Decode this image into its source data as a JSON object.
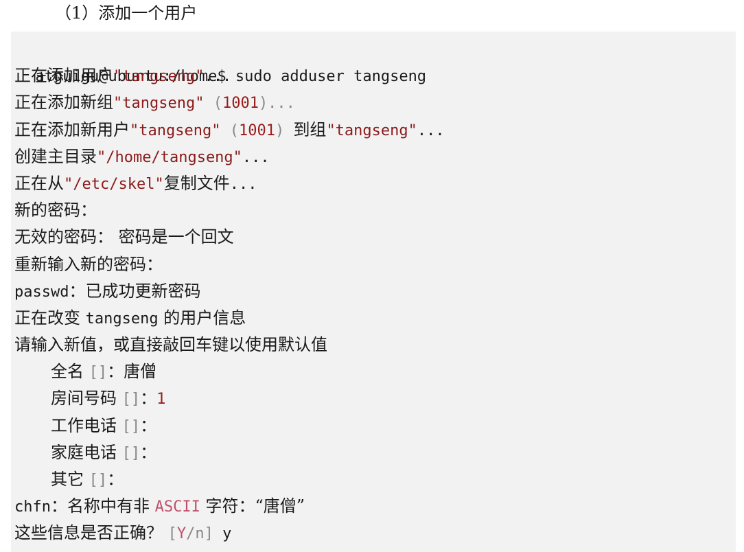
{
  "heading": "（1）添加一个用户",
  "lines": [
    {
      "cmd": "atguigu@ubuntu:/home$ sudo adduser tangseng"
    },
    {
      "a": "正在添加用户",
      "b": "\"tangseng\"",
      "c": "..."
    },
    {
      "a": "正在添加新组",
      "b": "\"tangseng\"",
      "c": " (",
      "d": "1001",
      "e": ")..."
    },
    {
      "a": "正在添加新用户",
      "b": "\"tangseng\"",
      "c": " (",
      "d": "1001",
      "e": ") ",
      "f": "到组",
      "g": "\"tangseng\"",
      "h": "..."
    },
    {
      "a": "创建主目录",
      "b": "\"/home/tangseng\"",
      "c": "..."
    },
    {
      "a": "正在从",
      "b": "\"/etc/skel\"",
      "c": "复制文件",
      "d": "..."
    },
    {
      "a": "新的密码："
    },
    {
      "a": "无效的密码： 密码是一个回文"
    },
    {
      "a": "重新输入新的密码："
    },
    {
      "a": "passwd",
      "b": "：已成功更新密码"
    },
    {
      "a": "正在改变 ",
      "b": "tangseng",
      "c": " 的用户信息"
    },
    {
      "a": "请输入新值，或直接敲回车键以使用默认值"
    },
    {
      "a": "全名 ",
      "b": "[]",
      "c": "：唐僧"
    },
    {
      "a": "房间号码 ",
      "b": "[]",
      "c": "：",
      "d": "1"
    },
    {
      "a": "工作电话 ",
      "b": "[]",
      "c": "："
    },
    {
      "a": "家庭电话 ",
      "b": "[]",
      "c": "："
    },
    {
      "a": "其它 ",
      "b": "[]",
      "c": "："
    },
    {
      "a": "chfn",
      "b": "：名称中有非 ",
      "c": "ASCII",
      "d": " 字符：“唐僧”"
    },
    {
      "a": "这些信息是否正确？ ",
      "b": "[",
      "c": "Y",
      "d": "/n]",
      "e": " y"
    }
  ]
}
